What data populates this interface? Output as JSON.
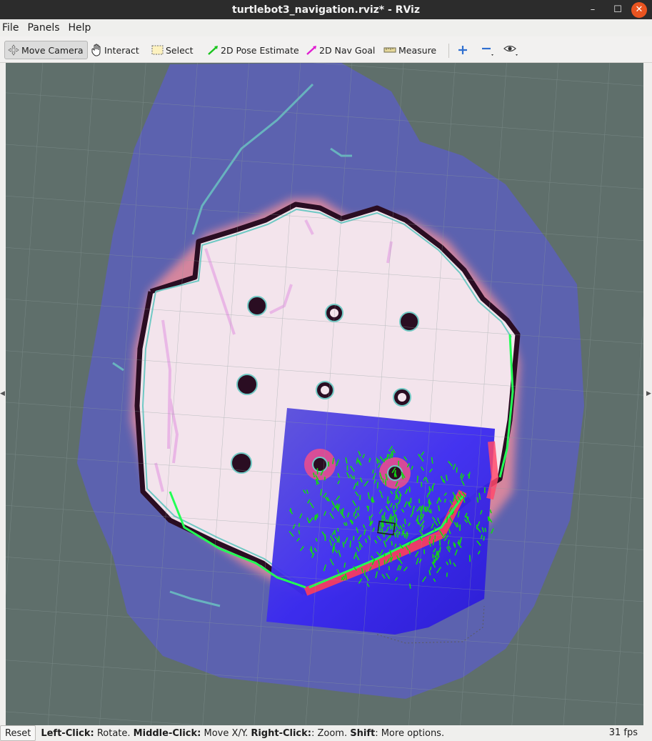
{
  "window": {
    "title": "turtlebot3_navigation.rviz* - RViz",
    "min": "–",
    "max": "☐",
    "close": "✕"
  },
  "menu": [
    "File",
    "Panels",
    "Help"
  ],
  "toolbar": {
    "move_camera": "Move Camera",
    "interact": "Interact",
    "select": "Select",
    "pose_estimate": "2D Pose Estimate",
    "nav_goal": "2D Nav Goal",
    "measure": "Measure"
  },
  "status": {
    "reset": "Reset",
    "left_click": "Left-Click:",
    "left_action": " Rotate. ",
    "middle_click": "Middle-Click:",
    "middle_action": " Move X/Y. ",
    "right_click": "Right-Click:",
    "right_action": ": Zoom. ",
    "shift": "Shift",
    "shift_action": ": More options.",
    "fps": "31 fps"
  },
  "colors": {
    "background": "#5f6f6b",
    "global_costmap": "#5c61b5",
    "free_space": "#f1dde8",
    "walls": "#2a0d22",
    "local_costmap": "#3d2ef0",
    "particles": "#12d912",
    "laser": "#00ff44"
  },
  "icons": {
    "move_camera": "move-camera-icon",
    "interact": "hand-icon",
    "select": "select-box-icon",
    "pose_estimate": "green-arrow-icon",
    "nav_goal": "magenta-arrow-icon",
    "measure": "ruler-icon",
    "zoom_in": "plus-icon",
    "zoom_out": "minus-icon",
    "view": "eye-icon"
  }
}
